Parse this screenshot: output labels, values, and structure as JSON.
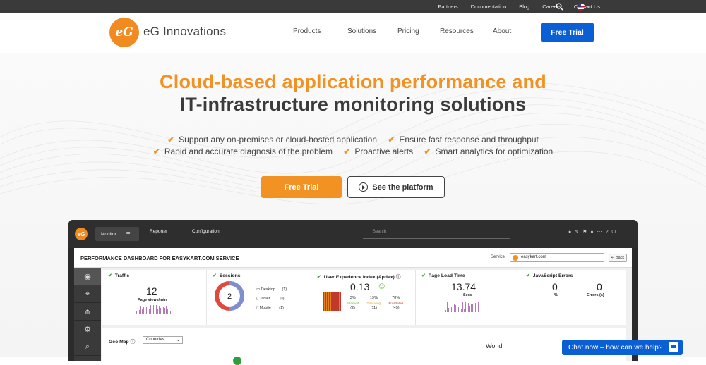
{
  "topbar": {
    "links": [
      "Partners",
      "Documentation",
      "Blog",
      "Careers",
      "Contact Us"
    ]
  },
  "header": {
    "logo_text": "eG",
    "brand": "eG Innovations",
    "nav": [
      "Products",
      "Solutions",
      "Pricing",
      "Resources",
      "About"
    ],
    "cta": "Free Trial"
  },
  "hero": {
    "title_line1": "Cloud-based application performance and",
    "title_line2": "IT-infrastructure monitoring solutions",
    "bullets_row1": [
      "Support any on-premises or cloud-hosted application",
      "Ensure fast response and throughput"
    ],
    "bullets_row2": [
      "Rapid and accurate diagnosis of the problem",
      "Proactive alerts",
      "Smart analytics for optimization"
    ],
    "primary_button": "Free Trial",
    "secondary_button": "See the platform"
  },
  "dashboard": {
    "logo": "eG",
    "tabs": [
      "Monitor",
      "Reporter",
      "Configuration"
    ],
    "search_placeholder": "Search",
    "title": "PERFORMANCE DASHBOARD FOR EASYKART.COM SERVICE",
    "service_label": "Service",
    "service_value": "easykart.com",
    "back_label": "Back",
    "cards": {
      "traffic": {
        "title": "Traffic",
        "value": "12",
        "unit": "Page views/min"
      },
      "sessions": {
        "title": "Sessions",
        "value": "2",
        "desktop": "Desktop",
        "desktop_n": "(1)",
        "tablet": "Tablet",
        "tablet_n": "(0)",
        "mobile": "Mobile",
        "mobile_n": "(1)"
      },
      "apdex": {
        "title": "User Experience Index (Apdex)",
        "value": "0.13",
        "satisfied_pct": "3%",
        "tolerating_pct": "19%",
        "frustrated_pct": "78%",
        "satisfied": "Satisfied",
        "tolerating": "Tolerating",
        "frustrated": "Frustrated",
        "satisfied_n": "(2)",
        "tolerating_n": "(11)",
        "frustrated_n": "(45)"
      },
      "pageload": {
        "title": "Page Load Time",
        "value": "13.74",
        "unit": "Secs"
      },
      "jserrors": {
        "title": "JavaScript Errors",
        "value1": "0",
        "unit1": "%",
        "value2": "0",
        "unit2": "Errors (s)"
      }
    },
    "geo": {
      "label": "Geo Map",
      "select": "Countries",
      "world": "World"
    }
  },
  "chat": {
    "label": "Chat now – how can we help?"
  }
}
